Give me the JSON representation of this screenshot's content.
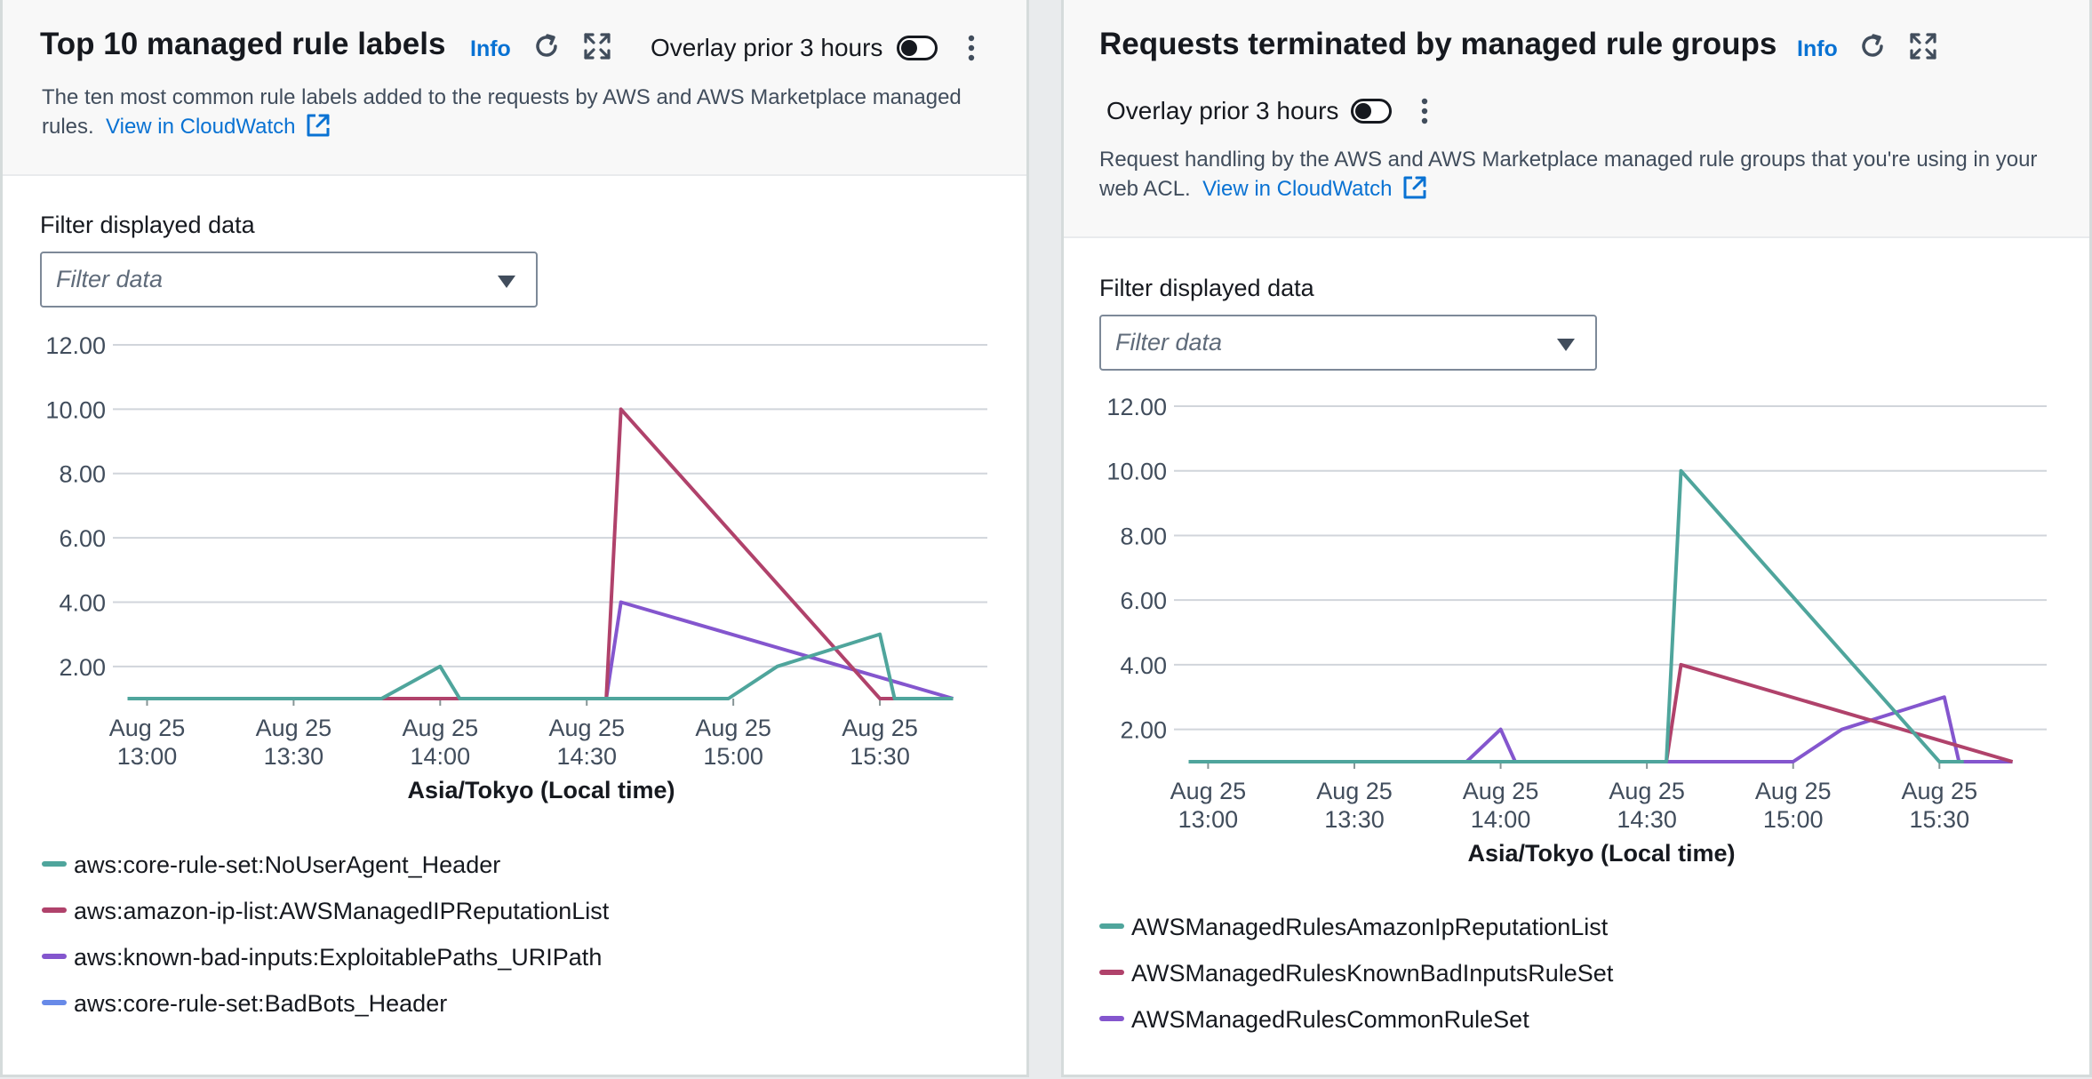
{
  "panels": [
    {
      "title": "Top 10 managed rule labels",
      "info": "Info",
      "overlay_label": "Overlay prior 3 hours",
      "description": "The ten most common rule labels added to the requests by AWS and AWS Marketplace managed rules.",
      "cloudwatch_link": "View in CloudWatch",
      "filter_label": "Filter displayed data",
      "filter_placeholder": "Filter data",
      "icons": [
        "refresh-icon",
        "fullscreen-icon",
        "more-vertical-icon",
        "external-link-icon",
        "caret-down-icon"
      ]
    },
    {
      "title": "Requests terminated by managed rule groups",
      "info": "Info",
      "overlay_label": "Overlay prior 3 hours",
      "description": "Request handling by the AWS and AWS Marketplace managed rule groups that you're using in your web ACL.",
      "cloudwatch_link": "View in CloudWatch",
      "filter_label": "Filter displayed data",
      "filter_placeholder": "Filter data",
      "icons": [
        "refresh-icon",
        "fullscreen-icon",
        "more-vertical-icon",
        "external-link-icon",
        "caret-down-icon"
      ]
    }
  ],
  "chart_data": [
    {
      "type": "line",
      "title": "Top 10 managed rule labels",
      "xlabel": "Asia/Tokyo (Local time)",
      "ylabel": "",
      "x_unit": "minutes",
      "xlim": [
        "12:53",
        "15:52"
      ],
      "ylim": [
        1,
        12
      ],
      "yticks": [
        2,
        4,
        6,
        8,
        10,
        12
      ],
      "ytick_labels": [
        "2.00",
        "4.00",
        "6.00",
        "8.00",
        "10.00",
        "12.00"
      ],
      "xticks": [
        "13:00",
        "13:30",
        "14:00",
        "14:30",
        "15:00",
        "15:30"
      ],
      "xtick_labels": [
        [
          "Aug 25",
          "13:00"
        ],
        [
          "Aug 25",
          "13:30"
        ],
        [
          "Aug 25",
          "14:00"
        ],
        [
          "Aug 25",
          "14:30"
        ],
        [
          "Aug 25",
          "15:00"
        ],
        [
          "Aug 25",
          "15:30"
        ]
      ],
      "grid": true,
      "legend_position": "bottom",
      "series": [
        {
          "name": "aws:core-rule-set:NoUserAgent_Header",
          "color": "#4fa59c",
          "x": [
            "12:56",
            "13:48",
            "14:00",
            "14:04",
            "14:59",
            "15:09",
            "15:30",
            "15:33",
            "15:45"
          ],
          "y": [
            1,
            1,
            2,
            1,
            1,
            2,
            3,
            1,
            1
          ]
        },
        {
          "name": "aws:amazon-ip-list:AWSManagedIPReputationList",
          "color": "#b0426b",
          "x": [
            "13:11",
            "14:34",
            "14:37",
            "15:30",
            "15:45"
          ],
          "y": [
            1,
            1,
            10,
            1,
            1
          ]
        },
        {
          "name": "aws:known-bad-inputs:ExploitablePaths_URIPath",
          "color": "#8456ce",
          "x": [
            "13:18",
            "14:34",
            "14:37",
            "15:45"
          ],
          "y": [
            1,
            1,
            4,
            1
          ]
        },
        {
          "name": "aws:core-rule-set:BadBots_Header",
          "color": "#688ae8",
          "x": [
            "13:38",
            "14:34"
          ],
          "y": [
            1,
            1
          ]
        }
      ]
    },
    {
      "type": "line",
      "title": "Requests terminated by managed rule groups",
      "xlabel": "Asia/Tokyo (Local time)",
      "ylabel": "",
      "x_unit": "minutes",
      "xlim": [
        "12:53",
        "15:52"
      ],
      "ylim": [
        1,
        12
      ],
      "yticks": [
        2,
        4,
        6,
        8,
        10,
        12
      ],
      "ytick_labels": [
        "2.00",
        "4.00",
        "6.00",
        "8.00",
        "10.00",
        "12.00"
      ],
      "xticks": [
        "13:00",
        "13:30",
        "14:00",
        "14:30",
        "15:00",
        "15:30"
      ],
      "xtick_labels": [
        [
          "Aug 25",
          "13:00"
        ],
        [
          "Aug 25",
          "13:30"
        ],
        [
          "Aug 25",
          "14:00"
        ],
        [
          "Aug 25",
          "14:30"
        ],
        [
          "Aug 25",
          "15:00"
        ],
        [
          "Aug 25",
          "15:30"
        ]
      ],
      "grid": true,
      "legend_position": "bottom",
      "series": [
        {
          "name": "AWSManagedRulesAmazonIpReputationList",
          "color": "#4fa59c",
          "x": [
            "12:56",
            "14:34",
            "14:37",
            "15:30",
            "15:35"
          ],
          "y": [
            1,
            1,
            10,
            1,
            1
          ]
        },
        {
          "name": "AWSManagedRulesKnownBadInputsRuleSet",
          "color": "#b0426b",
          "x": [
            "12:56",
            "14:34",
            "14:37",
            "15:45"
          ],
          "y": [
            1,
            1,
            4,
            1
          ]
        },
        {
          "name": "AWSManagedRulesCommonRuleSet",
          "color": "#8456ce",
          "x": [
            "12:56",
            "13:53",
            "14:00",
            "14:03",
            "15:00",
            "15:10",
            "15:31",
            "15:34",
            "15:45"
          ],
          "y": [
            1,
            1,
            2,
            1,
            1,
            2,
            3,
            1,
            1
          ]
        }
      ]
    }
  ]
}
